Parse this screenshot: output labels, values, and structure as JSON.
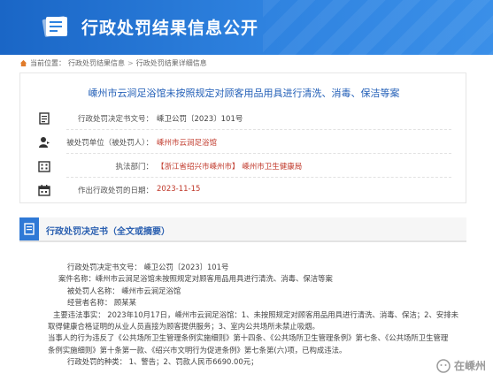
{
  "header": {
    "title": "行政处罚结果信息公开"
  },
  "breadcrumb": {
    "prefix": "当前位置：",
    "items": [
      "行政处罚结果信息",
      "行政处罚结果详细信息"
    ],
    "separator": ">"
  },
  "case": {
    "headline": "嵊州市云涧足浴馆未按照规定对顾客用品用具进行清洗、消毒、保洁等案",
    "rows": [
      {
        "icon": "document-icon",
        "label": "行政处罚决定书文号：",
        "value": "嵊卫公罚〔2023〕101号"
      },
      {
        "icon": "person-icon",
        "label": "被处罚单位（被处罚人）：",
        "value": "嵊州市云涧足浴馆"
      },
      {
        "icon": "building-icon",
        "label": "执法部门：",
        "value": "【浙江省绍兴市嵊州市】 嵊州市卫生健康局"
      },
      {
        "icon": "calendar-icon",
        "label": "作出行政处罚的日期：",
        "value": "2023-11-15"
      }
    ]
  },
  "decision": {
    "title": "行政处罚决定书（全文或摘要）",
    "lines": [
      "行政处罚决定书文号：  嵊卫公罚〔2023〕101号",
      "案件名称：嵊州市云涧足浴馆未按照规定对顾客用品用具进行清洗、消毒、保洁等案",
      "被处罚人名称：  嵊州市云涧足浴馆",
      "经营者名称：  顾某某",
      "主要违法事实：  2023年10月17日，嵊州市云涧足浴馆：1、未按照规定对顾客用品用具进行清洗、消毒、保洁；2、安排未",
      "取得健康合格证明的从业人员直接为顾客提供服务；3、室内公共场所未禁止吸烟。",
      "当事人的行为违反了《公共场所卫生管理条例实施细则》第十四条、《公共场所卫生管理条例》第七条、《公共场所卫生管理",
      "条例实施细则》第十条第一款、《绍兴市文明行为促进条例》第七条第(六)项，已构成违法。",
      "行政处罚的种类：  1、警告；2、罚款人民币6690.00元；"
    ]
  },
  "watermark": {
    "text": "在嵊州"
  },
  "colors": {
    "banner": "#1a66c6",
    "headline": "#2460b8",
    "accent_red": "#c0392b"
  }
}
